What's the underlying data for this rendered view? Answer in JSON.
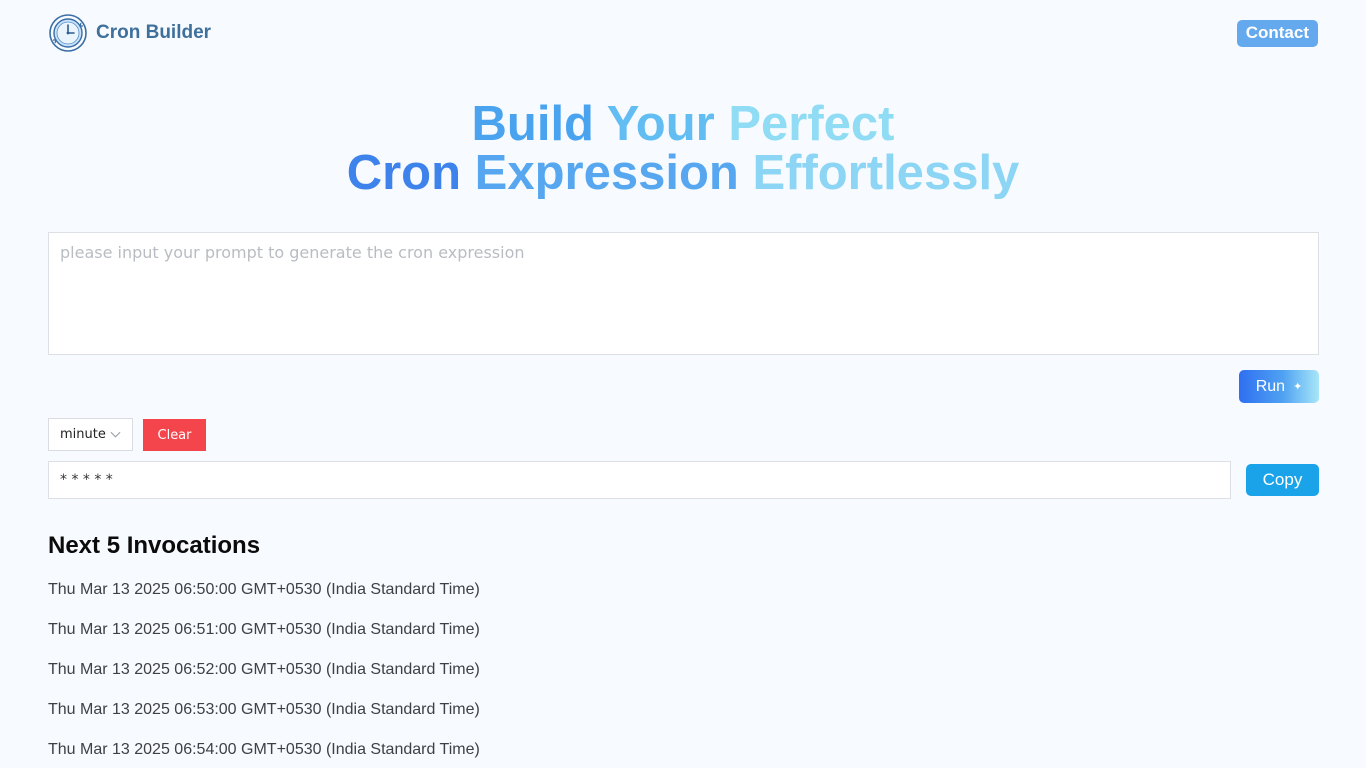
{
  "header": {
    "brand": "Cron Builder",
    "contact_label": "Contact"
  },
  "hero": {
    "line1": [
      "Build",
      "Your",
      "Perfect"
    ],
    "line2": [
      "Cron",
      "Expression",
      "Effortlessly"
    ]
  },
  "prompt": {
    "placeholder": "please input your prompt to generate the cron expression",
    "value": ""
  },
  "run_label": "Run",
  "controls": {
    "unit": "minute",
    "clear_label": "Clear"
  },
  "cron": {
    "expression": "* * * * *",
    "copy_label": "Copy"
  },
  "invocations": {
    "title": "Next 5 Invocations",
    "items": [
      "Thu Mar 13 2025 06:50:00 GMT+0530 (India Standard Time)",
      "Thu Mar 13 2025 06:51:00 GMT+0530 (India Standard Time)",
      "Thu Mar 13 2025 06:52:00 GMT+0530 (India Standard Time)",
      "Thu Mar 13 2025 06:53:00 GMT+0530 (India Standard Time)",
      "Thu Mar 13 2025 06:54:00 GMT+0530 (India Standard Time)"
    ]
  },
  "icons": {
    "logo": "clock-icon",
    "unit_select": "chevron-down-icon",
    "run": "sparkle-icon"
  },
  "colors": {
    "background": "#f7fbff",
    "brand_text": "#3f6f9b",
    "contact_button": "#64a9ee",
    "clear_button": "#f4444c",
    "copy_button": "#1aa3e8",
    "run_gradient_start": "#2f6ff1",
    "run_gradient_end": "#a8e6f8"
  }
}
